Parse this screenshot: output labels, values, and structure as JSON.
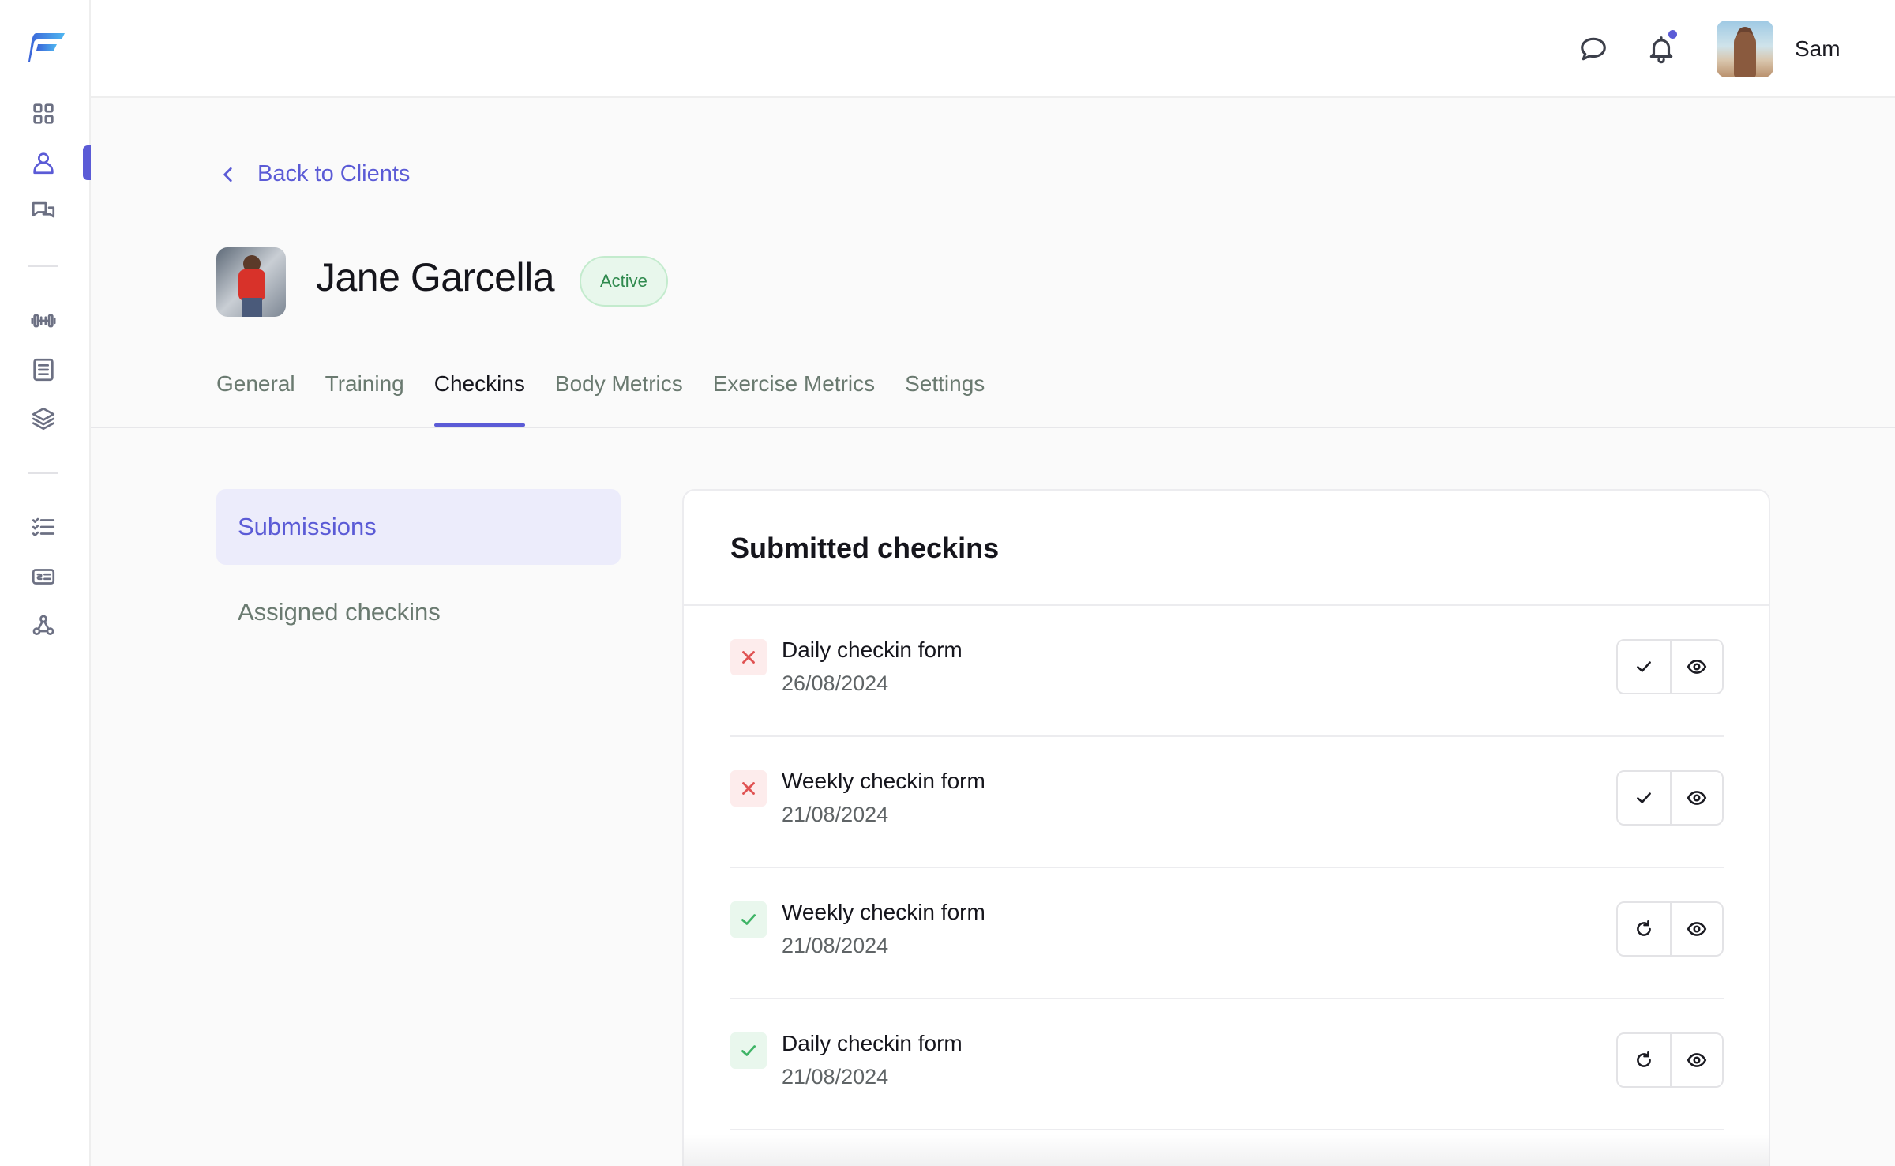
{
  "app": {
    "brand_color": "#5b5bd6",
    "logo_icon": "brand-logo-icon"
  },
  "sidebar": {
    "items": [
      {
        "name": "dashboard",
        "icon": "grid-icon"
      },
      {
        "name": "clients",
        "icon": "user-icon",
        "active": true
      },
      {
        "name": "messages",
        "icon": "chat-bubbles-icon"
      },
      {
        "name": "exercises",
        "icon": "dumbbell-icon"
      },
      {
        "name": "programs",
        "icon": "list-document-icon"
      },
      {
        "name": "library",
        "icon": "layers-icon"
      },
      {
        "name": "checkins",
        "icon": "checklist-icon"
      },
      {
        "name": "payments",
        "icon": "invoice-icon"
      },
      {
        "name": "integrations",
        "icon": "webhook-icon"
      }
    ]
  },
  "topbar": {
    "chat_icon": "chat-icon",
    "notification_icon": "bell-icon",
    "has_notification": true,
    "user_name": "Sam"
  },
  "header": {
    "back_label": "Back to Clients",
    "client_name": "Jane Garcella",
    "status": "Active"
  },
  "tabs": [
    {
      "label": "General"
    },
    {
      "label": "Training"
    },
    {
      "label": "Checkins",
      "active": true
    },
    {
      "label": "Body Metrics"
    },
    {
      "label": "Exercise Metrics"
    },
    {
      "label": "Settings"
    }
  ],
  "subnav": {
    "submissions": "Submissions",
    "assigned": "Assigned checkins"
  },
  "card": {
    "title": "Submitted checkins",
    "rows": [
      {
        "name": "Daily checkin form",
        "date": "26/08/2024",
        "status": "not-reviewed",
        "primary_action": "mark-reviewed"
      },
      {
        "name": "Weekly checkin form",
        "date": "21/08/2024",
        "status": "not-reviewed",
        "primary_action": "mark-reviewed"
      },
      {
        "name": "Weekly checkin form",
        "date": "21/08/2024",
        "status": "reviewed",
        "primary_action": "reset"
      },
      {
        "name": "Daily checkin form",
        "date": "21/08/2024",
        "status": "reviewed",
        "primary_action": "reset"
      }
    ]
  }
}
